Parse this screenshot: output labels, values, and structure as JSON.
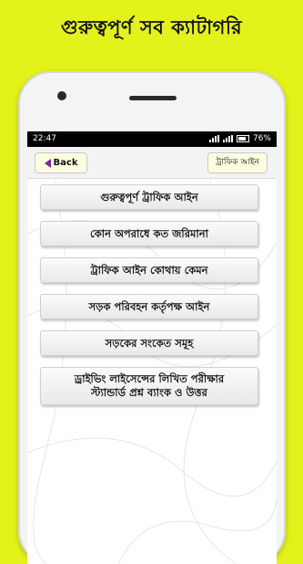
{
  "banner": {
    "title": "গুরুত্বপূর্ণ সব ক্যাটাগরি"
  },
  "status_bar": {
    "time": "22:47",
    "battery": "76%"
  },
  "toolbar": {
    "back_label": "Back",
    "section_label": "ট্রাফিক আইন"
  },
  "menu": {
    "items": [
      {
        "label": "গুরুত্বপূর্ণ ট্রাফিক আইন"
      },
      {
        "label": "কোন অপরাধে কত জরিমানা"
      },
      {
        "label": "ট্রাফিক আইন কোথায় কেমন"
      },
      {
        "label": "সড়ক পরিবহন কর্তৃপক্ষ আইন"
      },
      {
        "label": "সড়কের সংকেত সমূহ"
      },
      {
        "label": "ড্রাইভিং লাইসেন্সের লিখিত পরীক্ষার\nস্ট্যান্ডার্ড প্রশ্ন ব্যাংক ও উত্তর"
      }
    ]
  }
}
